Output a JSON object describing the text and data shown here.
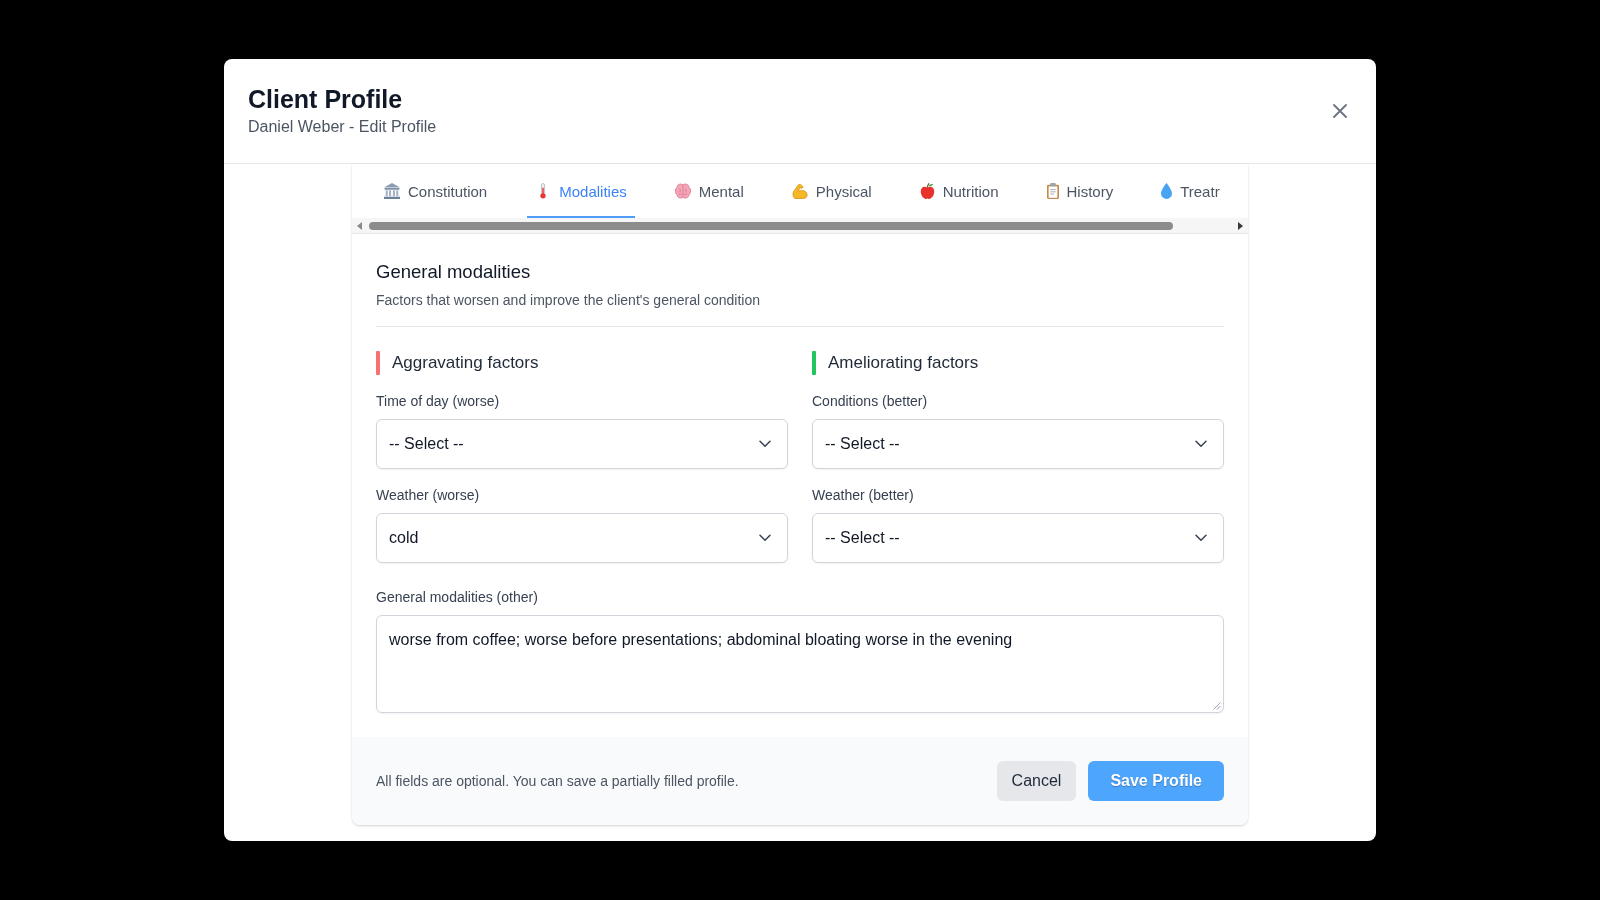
{
  "dialog": {
    "title": "Client Profile",
    "subtitle": "Daniel Weber - Edit Profile"
  },
  "tabs": [
    {
      "label": "Constitution",
      "selected": false
    },
    {
      "label": "Modalities",
      "selected": true
    },
    {
      "label": "Mental",
      "selected": false
    },
    {
      "label": "Physical",
      "selected": false
    },
    {
      "label": "Nutrition",
      "selected": false
    },
    {
      "label": "History",
      "selected": false
    },
    {
      "label": "Treatr",
      "selected": false
    }
  ],
  "section": {
    "title": "General modalities",
    "description": "Factors that worsen and improve the client's general condition"
  },
  "columns": [
    {
      "heading": "Aggravating factors",
      "color": "#f87171",
      "fields": [
        {
          "label": "Time of day (worse)",
          "value": "-- Select --"
        },
        {
          "label": "Weather (worse)",
          "value": "cold"
        }
      ]
    },
    {
      "heading": "Ameliorating factors",
      "color": "#22c55e",
      "fields": [
        {
          "label": "Conditions (better)",
          "value": "-- Select --"
        },
        {
          "label": "Weather (better)",
          "value": "-- Select --"
        }
      ]
    }
  ],
  "other": {
    "label": "General modalities (other)",
    "value": "worse from coffee; worse before presentations; abdominal bloating worse in the evening"
  },
  "footer": {
    "note": "All fields are optional. You can save a partially filled profile.",
    "buttons": [
      {
        "label": "Cancel",
        "kind": "secondary"
      },
      {
        "label": "Save Profile",
        "kind": "primary"
      }
    ]
  }
}
